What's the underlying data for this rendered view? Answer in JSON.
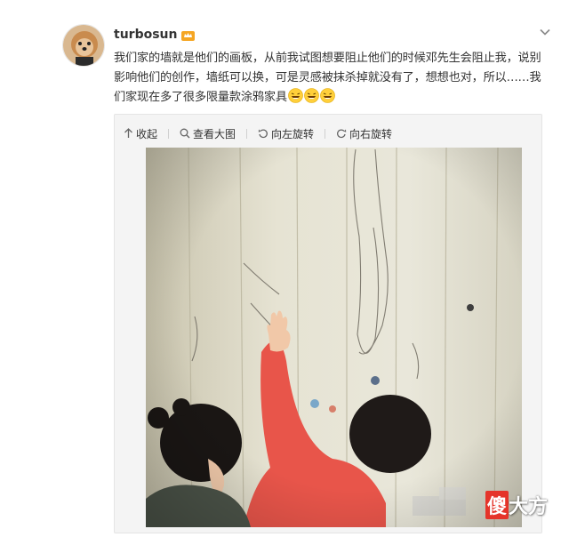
{
  "post": {
    "username": "turbosun",
    "text": "我们家的墙就是他们的画板，从前我试图想要阻止他们的时候邓先生会阻止我，说别影响他们的创作，墙纸可以换，可是灵感被抹杀掉就没有了，想想也对，所以……我们家现在多了很多限量款涂鸦家具",
    "emojis": [
      "laughing-emoji",
      "laughing-emoji",
      "laughing-emoji"
    ]
  },
  "toolbar": {
    "collapse": "收起",
    "view_large": "查看大图",
    "rotate_left": "向左旋转",
    "rotate_right": "向右旋转"
  },
  "icons": {
    "collapse": "arrow-up-icon",
    "view_large": "magnifier-icon",
    "rotate_left": "rotate-left-icon",
    "rotate_right": "rotate-right-icon",
    "menu": "chevron-down-icon",
    "badge": "vip-crown-icon"
  },
  "watermark": {
    "first": "傻",
    "rest": "大方"
  },
  "colors": {
    "text": "#333333",
    "accent_orange": "#f5a623",
    "shirt_red": "#e8554a",
    "wall": "#e2dfd0"
  }
}
